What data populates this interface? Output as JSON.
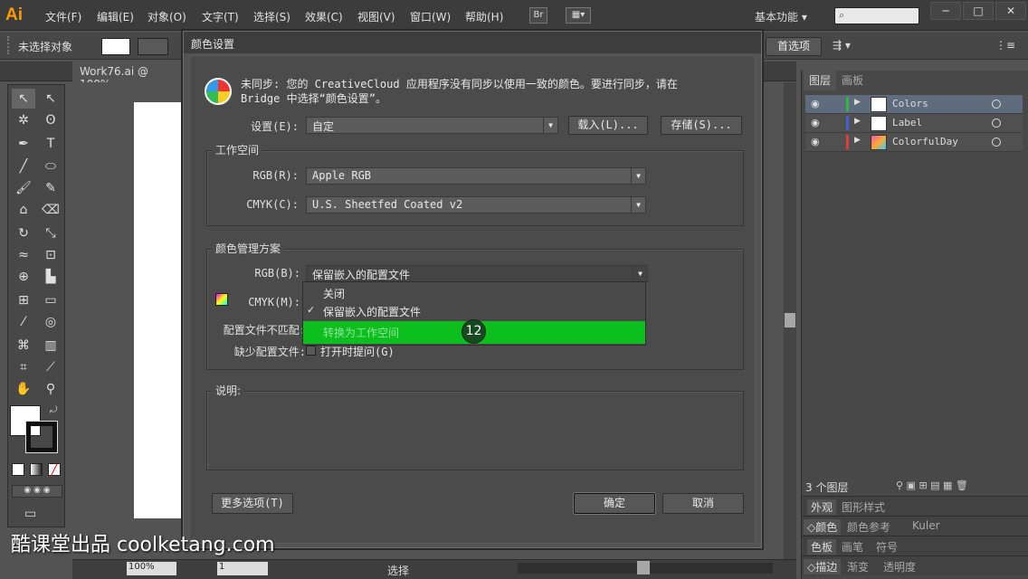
{
  "app": {
    "logo": "Ai",
    "menus": [
      "文件(F)",
      "编辑(E)",
      "对象(O)",
      "文字(T)",
      "选择(S)",
      "效果(C)",
      "视图(V)",
      "窗口(W)",
      "帮助(H)"
    ],
    "bridge_btn": "Br",
    "workspace": "基本功能",
    "window_buttons": [
      "─",
      "□",
      "✕"
    ]
  },
  "control_bar": {
    "selection": "未选择对象",
    "prefs_button": "首选项"
  },
  "document": {
    "tab": "Work76.ai @ 100%"
  },
  "status": {
    "zoom": "100%",
    "page": "1",
    "tool": "选择"
  },
  "layers_panel": {
    "tabs": [
      "图层",
      "画板"
    ],
    "layers": [
      {
        "name": "Colors",
        "color": "#37b34a"
      },
      {
        "name": "Label",
        "color": "#4b5bd6"
      },
      {
        "name": "ColorfulDay",
        "color": "#e03c3c"
      }
    ],
    "count": "3 个图层",
    "sections": [
      [
        "外观",
        "图形样式"
      ],
      [
        "颜色",
        "颜色参考",
        "Kuler"
      ],
      [
        "色板",
        "画笔",
        "符号"
      ],
      [
        "描边",
        "渐变",
        "透明度"
      ]
    ]
  },
  "dialog": {
    "title": "颜色设置",
    "sync_line1": "未同步: 您的 CreativeCloud 应用程序没有同步以使用一致的颜色。要进行同步，请在",
    "sync_line2": "Bridge 中选择“颜色设置”。",
    "settings_label": "设置(E):",
    "settings_value": "自定",
    "load_button": "载入(L)...",
    "save_button": "存储(S)...",
    "workspace_group": "工作空间",
    "rgb_label": "RGB(R):",
    "rgb_value": "Apple RGB",
    "cmyk_label": "CMYK(C):",
    "cmyk_value": "U.S. Sheetfed Coated v2",
    "policy_group": "颜色管理方案",
    "policy_rgb_label": "RGB(B):",
    "policy_rgb_value": "保留嵌入的配置文件",
    "policy_cmyk_label": "CMYK(M):",
    "mismatch_label": "配置文件不匹配:",
    "missing_label": "缺少配置文件:",
    "missing_option": "打开时提问(G)",
    "desc_group": "说明:",
    "more_options": "更多选项(T)",
    "ok": "确定",
    "cancel": "取消"
  },
  "popup": {
    "items": [
      "关闭",
      "保留嵌入的配置文件",
      "转换为工作空间"
    ],
    "checked_index": 1,
    "highlighted_index": 2,
    "step_badge": "12"
  },
  "watermark": "酷课堂出品 coolketang.com"
}
